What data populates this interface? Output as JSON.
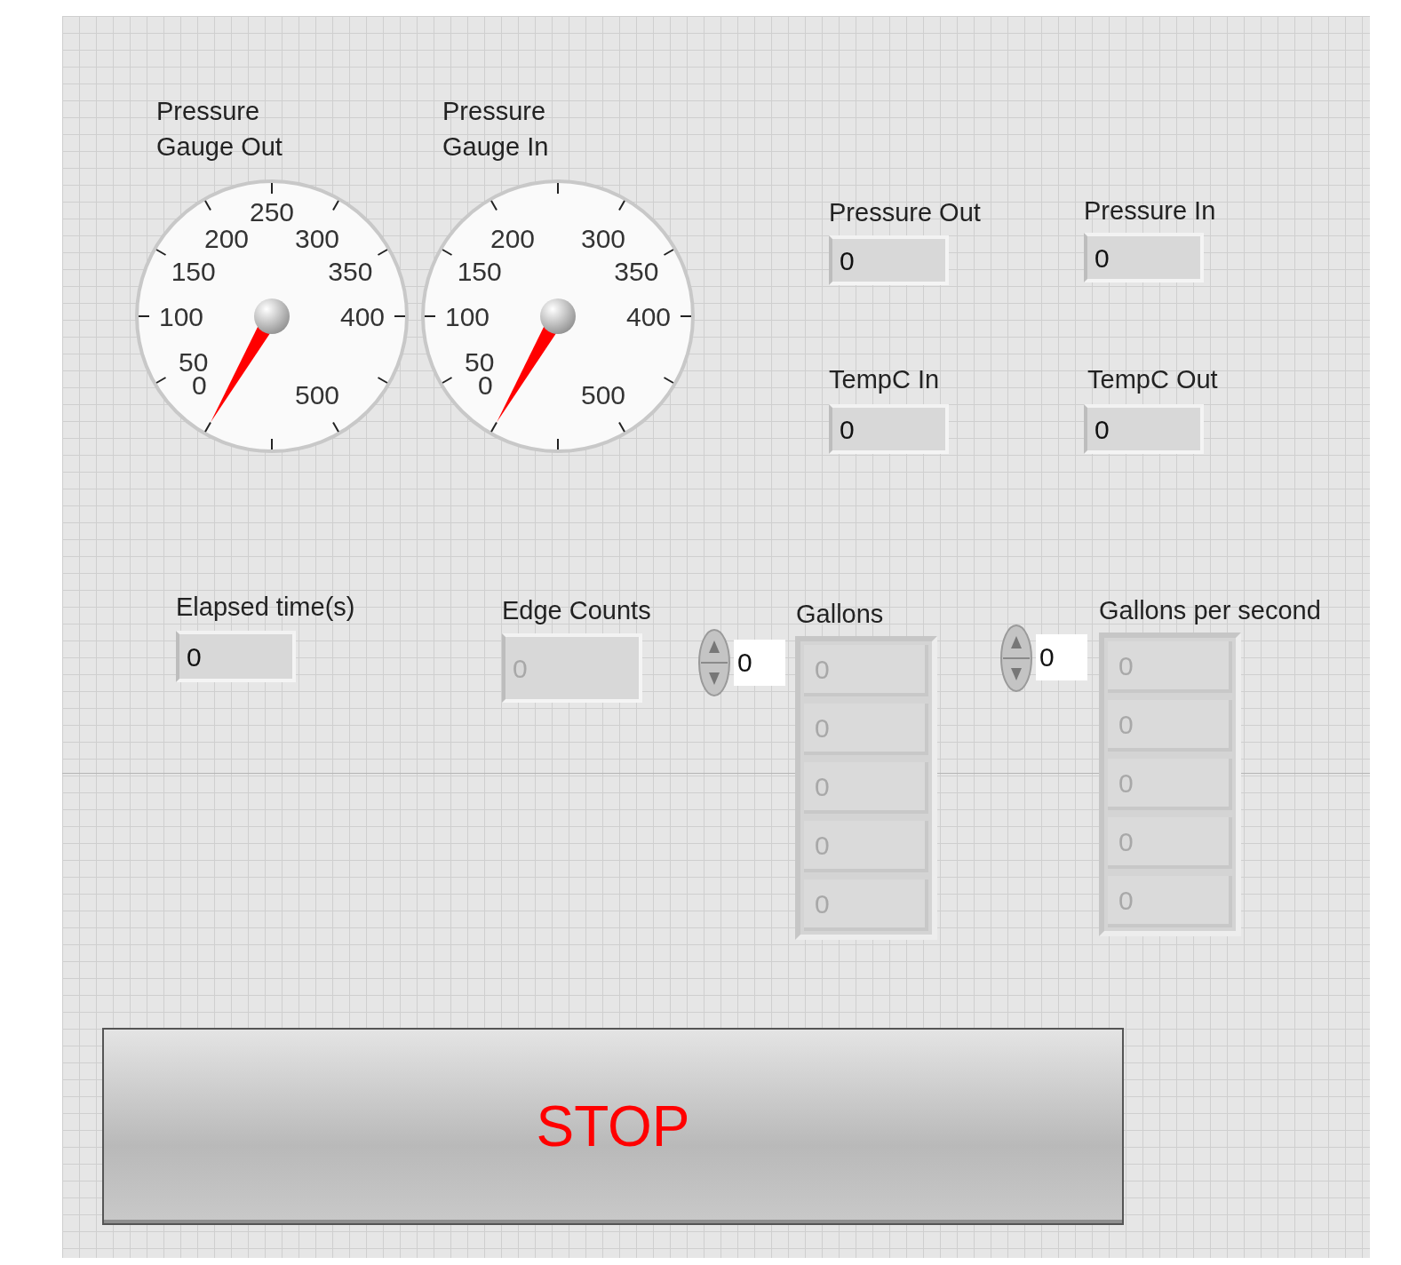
{
  "gauges": [
    {
      "label": "Pressure Gauge Out",
      "scale": [
        "250",
        "200",
        "300",
        "150",
        "350",
        "100",
        "400",
        "50",
        "0",
        "500"
      ]
    },
    {
      "label": "Pressure Gauge In",
      "scale": [
        "200",
        "300",
        "150",
        "350",
        "100",
        "400",
        "50",
        "0",
        "500"
      ]
    }
  ],
  "indicators": [
    {
      "label": "Pressure Out",
      "value": "0",
      "disabled": false
    },
    {
      "label": "Pressure In",
      "value": "0",
      "disabled": false
    },
    {
      "label": "TempC In",
      "value": "0",
      "disabled": false
    },
    {
      "label": "TempC Out",
      "value": "0",
      "disabled": false
    },
    {
      "label": "Elapsed time(s)",
      "value": "0",
      "disabled": false
    },
    {
      "label": "Edge Counts",
      "value": "0",
      "disabled": true
    }
  ],
  "arrays": [
    {
      "label": "Gallons",
      "index": "0",
      "elements": [
        {
          "value": "0",
          "disabled": true
        },
        {
          "value": "0",
          "disabled": true
        },
        {
          "value": "0",
          "disabled": true
        },
        {
          "value": "0",
          "disabled": true
        },
        {
          "value": "0",
          "disabled": true
        }
      ]
    },
    {
      "label": "Gallons per second",
      "index": "0",
      "elements": [
        {
          "value": "0",
          "disabled": true
        },
        {
          "value": "0",
          "disabled": true
        },
        {
          "value": "0",
          "disabled": true
        },
        {
          "value": "0",
          "disabled": true
        },
        {
          "value": "0",
          "disabled": true
        }
      ]
    }
  ],
  "stop_button": {
    "label": "STOP"
  }
}
